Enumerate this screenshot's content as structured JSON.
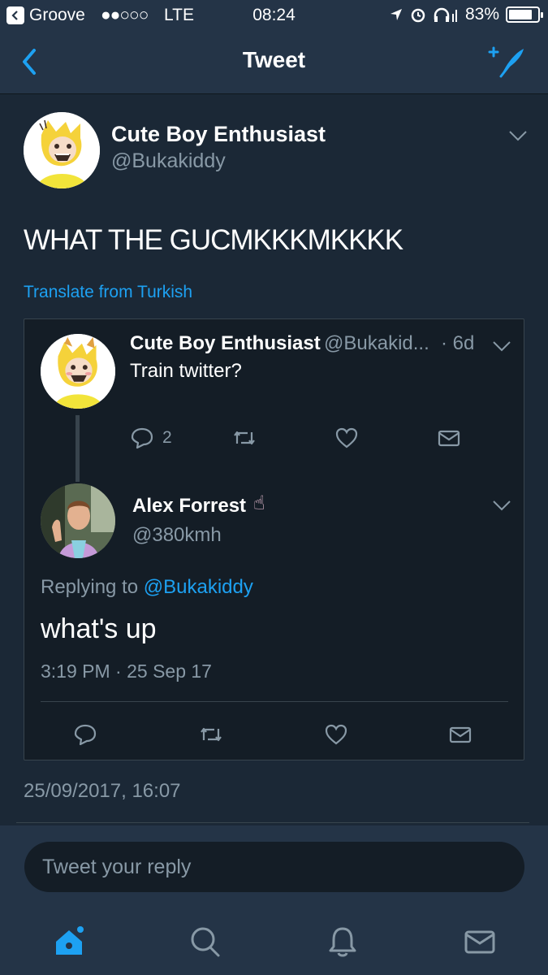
{
  "status_bar": {
    "carrier": "Groove",
    "signal_dots": "●●○○○",
    "network": "LTE",
    "time": "08:24",
    "battery_percent": "83%",
    "battery_level": 0.83
  },
  "nav": {
    "title": "Tweet"
  },
  "tweet": {
    "author_name": "Cute Boy Enthusiast",
    "author_handle": "@Bukakiddy",
    "text": "WHAT THE GUCMKKKMKKKK",
    "translate_label": "Translate from Turkish",
    "timestamp": "25/09/2017, 16:07"
  },
  "quoted": {
    "author_name": "Cute Boy Enthusiast",
    "author_handle": "@Bukakid...",
    "time_ago": "· 6d",
    "text": "Train twitter?",
    "reply_count": "2",
    "reply": {
      "author_name": "Alex Forrest",
      "author_emoji": "☝",
      "author_handle": "@380kmh",
      "replying_prefix": "Replying to",
      "replying_handle": "@Bukakiddy",
      "text": "what's up",
      "timestamp": "3:19 PM · 25 Sep 17"
    }
  },
  "reply_box": {
    "placeholder": "Tweet your reply"
  },
  "colors": {
    "accent": "#1da1f2",
    "background": "#141d26",
    "bar": "#243447",
    "muted": "#8899a6"
  },
  "icons": [
    "back-icon",
    "compose-tweet-icon",
    "chevron-down-icon",
    "reply-icon",
    "retweet-icon",
    "like-icon",
    "dm-icon",
    "home-icon",
    "search-icon",
    "notifications-icon",
    "messages-icon"
  ]
}
